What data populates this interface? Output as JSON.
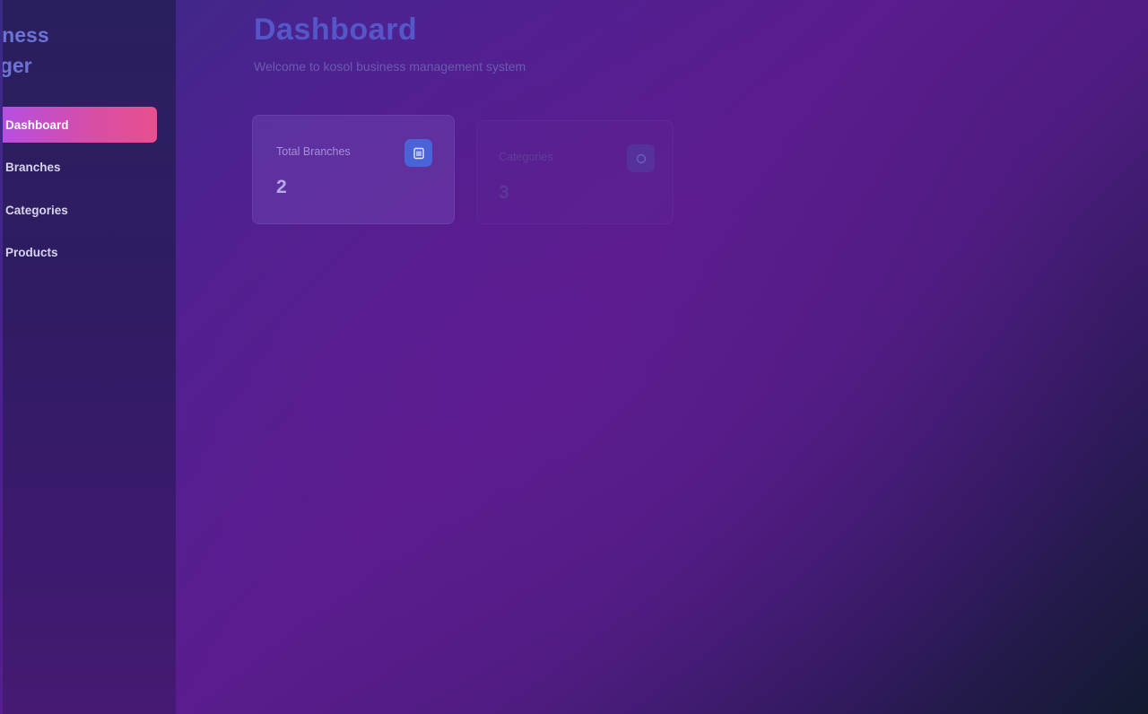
{
  "sidebar": {
    "brand_line1": "siness",
    "brand_line2": "nager",
    "items": [
      {
        "label": "Dashboard",
        "active": true
      },
      {
        "label": "Branches"
      },
      {
        "label": "Categories"
      },
      {
        "label": "Products"
      }
    ]
  },
  "main": {
    "title": "Dashboard",
    "subtitle": "Welcome to kosol business management system",
    "cards": [
      {
        "label": "Total Branches",
        "value": "2",
        "icon": "building-icon"
      },
      {
        "label": "Categories",
        "value": "3",
        "icon": "tag-icon"
      }
    ]
  },
  "colors": {
    "accent_gradient_start": "#b64fe0",
    "accent_gradient_end": "#e84f8e",
    "brand": "#6b74d6"
  }
}
